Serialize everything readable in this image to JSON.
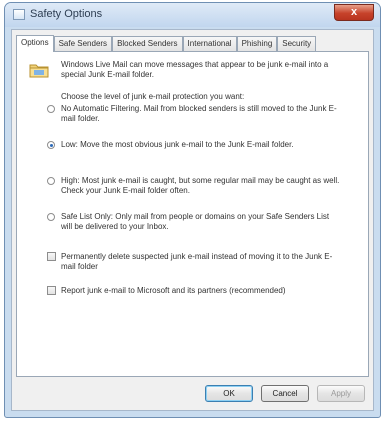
{
  "window": {
    "title": "Safety Options",
    "close_label": "x"
  },
  "tabs": [
    {
      "label": "Options",
      "active": true
    },
    {
      "label": "Safe Senders",
      "active": false
    },
    {
      "label": "Blocked Senders",
      "active": false
    },
    {
      "label": "International",
      "active": false
    },
    {
      "label": "Phishing",
      "active": false
    },
    {
      "label": "Security",
      "active": false
    }
  ],
  "options_panel": {
    "intro": "Windows Live Mail can move messages that appear to be junk e-mail into a special Junk E-mail folder.",
    "choose_level": "Choose the level of junk e-mail protection you want:",
    "levels": [
      {
        "text": "No Automatic Filtering.  Mail from blocked senders is still moved to the Junk E-mail folder.",
        "selected": false
      },
      {
        "text": "Low: Move the most obvious junk e-mail to the Junk E-mail folder.",
        "selected": true
      },
      {
        "text": "High: Most junk e-mail is caught, but some regular mail may be caught as well.  Check your Junk E-mail folder often.",
        "selected": false
      },
      {
        "text": "Safe List Only: Only mail from people or domains on your Safe Senders List will be delivered to your Inbox.",
        "selected": false
      }
    ],
    "checkboxes": [
      {
        "text": "Permanently delete suspected junk e-mail instead of moving it to the Junk E-mail folder",
        "checked": false
      },
      {
        "text": "Report junk e-mail to Microsoft and its partners (recommended)",
        "checked": false
      }
    ]
  },
  "buttons": {
    "ok": "OK",
    "cancel": "Cancel",
    "apply": "Apply"
  }
}
